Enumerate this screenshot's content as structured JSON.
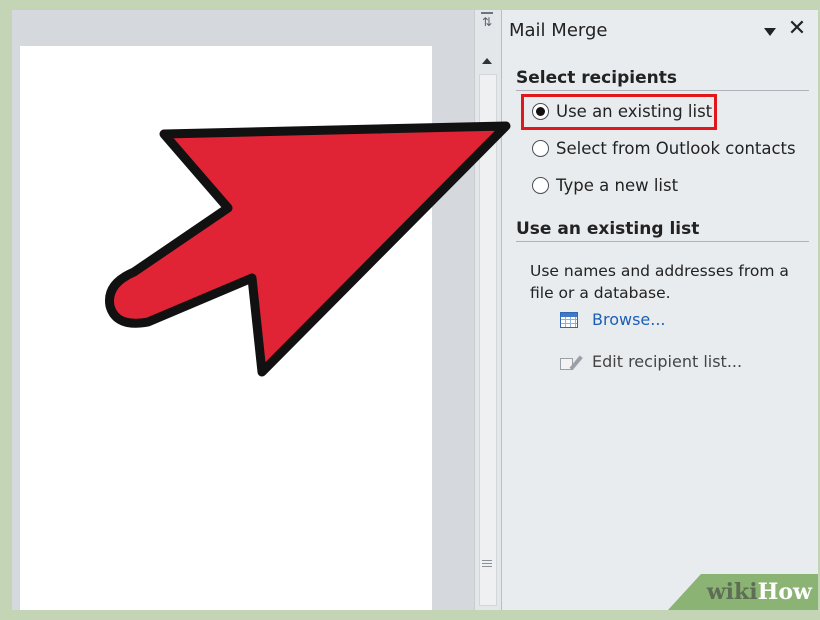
{
  "task_pane": {
    "title": "Mail Merge",
    "menu_icon": "dropdown-arrow",
    "close_icon": "close-x",
    "select_recipients": {
      "heading": "Select recipients",
      "options": [
        {
          "label": "Use an existing list",
          "checked": true
        },
        {
          "label": "Select from Outlook contacts",
          "checked": false
        },
        {
          "label": "Type a new list",
          "checked": false
        }
      ]
    },
    "use_existing_list": {
      "heading": "Use an existing list",
      "description": "Use names and addresses from a file or a database.",
      "browse_label": "Browse...",
      "edit_recipient_label": "Edit recipient list..."
    }
  },
  "watermark": {
    "wiki": "wiki",
    "how": "How"
  },
  "colors": {
    "arrow_fill": "#e02436",
    "highlight": "#e0171b",
    "link": "#1d5fb4",
    "watermark_bg": "#8bb373"
  }
}
